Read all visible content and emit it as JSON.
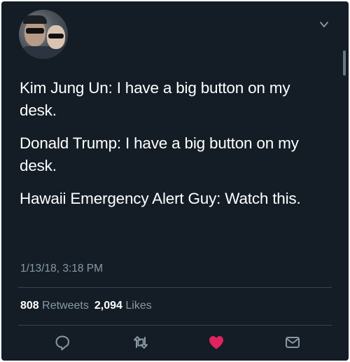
{
  "tweet": {
    "lines": [
      "Kim Jung Un: I have a big button on my desk.",
      "Donald Trump: I have a big button on my desk.",
      "Hawaii Emergency Alert Guy: Watch this."
    ],
    "timestamp": "1/13/18, 3:18 PM"
  },
  "stats": {
    "retweets_count": "808",
    "retweets_label": "Retweets",
    "likes_count": "2,094",
    "likes_label": "Likes"
  },
  "icons": {
    "menu": "chevron-down-icon",
    "reply": "reply-icon",
    "retweet": "retweet-icon",
    "like": "heart-icon",
    "message": "envelope-icon"
  },
  "colors": {
    "background": "#141d26",
    "text": "#ffffff",
    "muted": "#8899a6",
    "like": "#e0245e",
    "divider": "#38444d"
  }
}
